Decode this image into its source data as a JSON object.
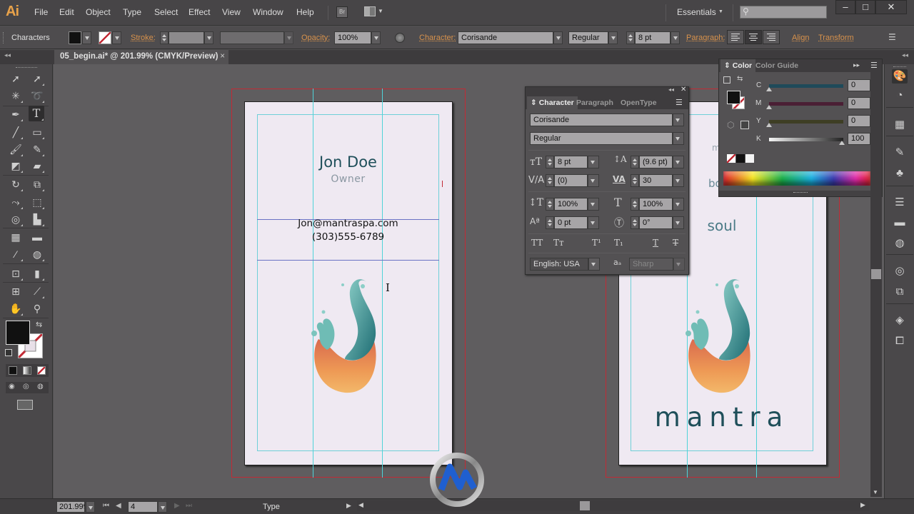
{
  "app": {
    "logo": "Ai"
  },
  "menu": [
    "File",
    "Edit",
    "Object",
    "Type",
    "Select",
    "Effect",
    "View",
    "Window",
    "Help"
  ],
  "menubar_extra": {
    "bridge_label": "Br",
    "workspace": "Essentials",
    "search_placeholder": ""
  },
  "window_controls": {
    "minimize": "–",
    "maximize": "□",
    "close": "✕"
  },
  "control_bar": {
    "selection_label": "Characters",
    "stroke_label": "Stroke:",
    "opacity_label": "Opacity:",
    "opacity_value": "100%",
    "character_label": "Character:",
    "font_family": "Corisande",
    "font_style": "Regular",
    "font_size": "8 pt",
    "paragraph_label": "Paragraph:",
    "align_label": "Align",
    "transform_label": "Transform"
  },
  "document_tab": {
    "title": "05_begin.ai* @ 201.99% (CMYK/Preview)",
    "close": "×"
  },
  "artboard_front": {
    "name": "Jon Doe",
    "title": "Owner",
    "email": "Jon@mantraspa.com",
    "phone": "(303)555-6789"
  },
  "artboard_back": {
    "partial_1": "m",
    "partial_2": "bo",
    "word": "soul",
    "brand": "mantra"
  },
  "character_panel": {
    "tabs": [
      "Character",
      "Paragraph",
      "OpenType"
    ],
    "active_tab": "Character",
    "font_family": "Corisande",
    "font_style": "Regular",
    "font_size": "8 pt",
    "leading": "(9.6 pt)",
    "kerning": "(0)",
    "tracking": "30",
    "vertical_scale": "100%",
    "horizontal_scale": "100%",
    "baseline_shift": "0 pt",
    "rotation": "0°",
    "language": "English: USA",
    "antialiasing": "Sharp",
    "style_buttons": [
      "TT",
      "Tт",
      "T¹",
      "T₁",
      "T",
      "T"
    ]
  },
  "color_panel": {
    "tabs": [
      "Color",
      "Color Guide"
    ],
    "active_tab": "Color",
    "channels": [
      {
        "label": "C",
        "value": "0",
        "unit": "%",
        "color": "#1f4a5a"
      },
      {
        "label": "M",
        "value": "0",
        "unit": "%",
        "color": "#5a1f3a"
      },
      {
        "label": "Y",
        "value": "0",
        "unit": "%",
        "color": "#4a4a1f"
      },
      {
        "label": "K",
        "value": "100",
        "unit": "%",
        "color": "#222222"
      }
    ]
  },
  "status_bar": {
    "zoom": "201.999",
    "artboard_number": "4",
    "current_tool": "Type"
  },
  "colors": {
    "accent_orange": "#d8924c",
    "bleed_red": "#c22a35",
    "guide_cyan": "#4fd3d8",
    "name_teal": "#1f4f5a",
    "title_gray": "#8a97a2"
  }
}
